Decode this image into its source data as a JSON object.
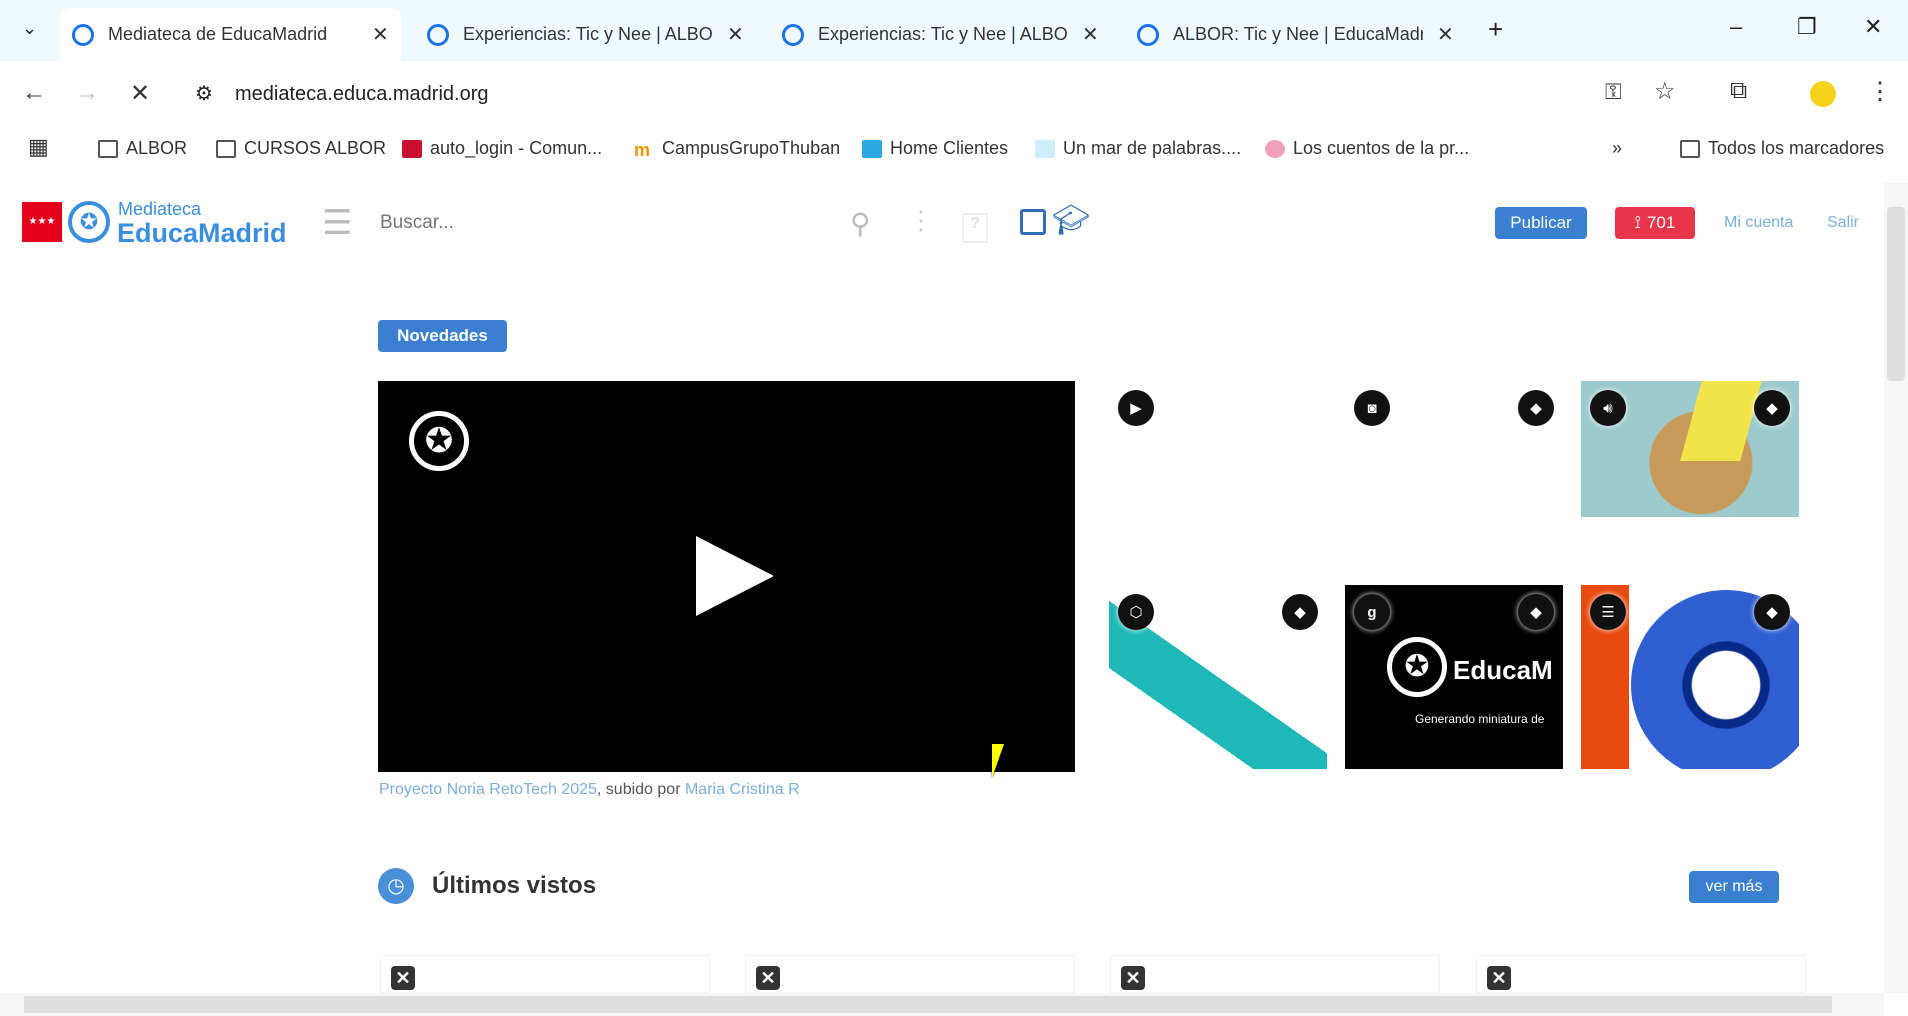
{
  "browser": {
    "tabs": [
      {
        "title": "Mediateca de EducaMadrid",
        "active": true
      },
      {
        "title": "Experiencias: Tic y Nee | ALBOR",
        "active": false
      },
      {
        "title": "Experiencias: Tic y Nee | ALBOR",
        "active": false
      },
      {
        "title": "ALBOR: Tic y Nee | EducaMadrid",
        "active": false
      }
    ],
    "url": "mediateca.educa.madrid.org",
    "bookmarks": [
      "ALBOR",
      "CURSOS ALBOR",
      "auto_login - Comun...",
      "CampusGrupoThuban",
      "Home Clientes",
      "Un mar de palabras....",
      "Los cuentos de la pr..."
    ],
    "all_bookmarks": "Todos los marcadores"
  },
  "header": {
    "logo_top": "Mediateca",
    "logo_bottom": "EducaMadrid",
    "search_placeholder": "Buscar...",
    "publish": "Publicar",
    "rss_count": "701",
    "account": "Mi cuenta",
    "logout": "Salir"
  },
  "main": {
    "novedades": "Novedades",
    "caption": {
      "title": "Proyecto Noria RetoTech 2025",
      "sep": ", subido por ",
      "author": "Maria Cristina R"
    },
    "thumb_text": {
      "brand": "EducaM",
      "generating": "Generando miniatura de"
    },
    "recent_title": "Últimos vistos",
    "see_more": "ver más"
  },
  "colors": {
    "primary": "#3a7fd0",
    "rss": "#e8354a",
    "link": "#7aaedc"
  }
}
